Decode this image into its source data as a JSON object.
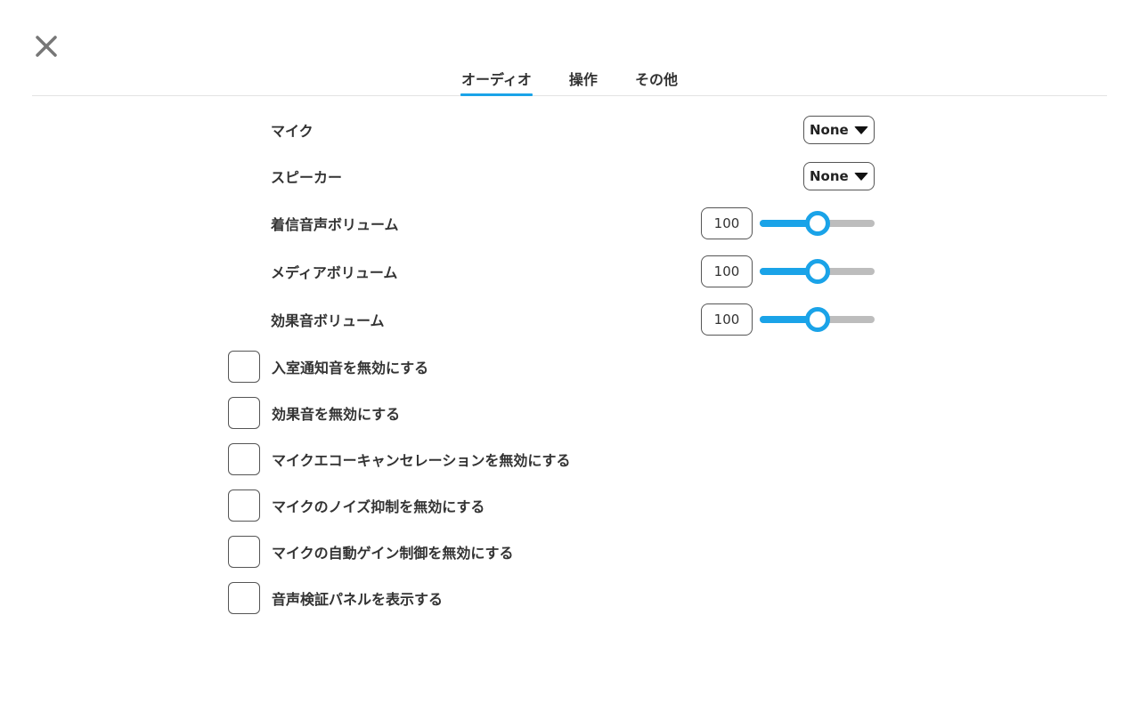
{
  "tabs": [
    {
      "label": "オーディオ",
      "active": true
    },
    {
      "label": "操作",
      "active": false
    },
    {
      "label": "その他",
      "active": false
    }
  ],
  "devices": {
    "mic": {
      "label": "マイク",
      "value": "None"
    },
    "speaker": {
      "label": "スピーカー",
      "value": "None"
    }
  },
  "volumes": {
    "incoming": {
      "label": "着信音声ボリューム",
      "value": "100",
      "level": 0.5
    },
    "media": {
      "label": "メディアボリューム",
      "value": "100",
      "level": 0.5
    },
    "effects": {
      "label": "効果音ボリューム",
      "value": "100",
      "level": 0.5
    }
  },
  "checkboxes": [
    {
      "label": "入室通知音を無効にする",
      "checked": false
    },
    {
      "label": "効果音を無効にする",
      "checked": false
    },
    {
      "label": "マイクエコーキャンセレーションを無効にする",
      "checked": false
    },
    {
      "label": "マイクのノイズ抑制を無効にする",
      "checked": false
    },
    {
      "label": "マイクの自動ゲイン制御を無効にする",
      "checked": false
    },
    {
      "label": "音声検証パネルを表示する",
      "checked": false
    }
  ],
  "colors": {
    "accent": "#1aa3e8",
    "track": "#bdbdbd",
    "text": "#333333"
  },
  "icons": {
    "close": "close-icon",
    "dropdown": "caret-down-icon"
  }
}
